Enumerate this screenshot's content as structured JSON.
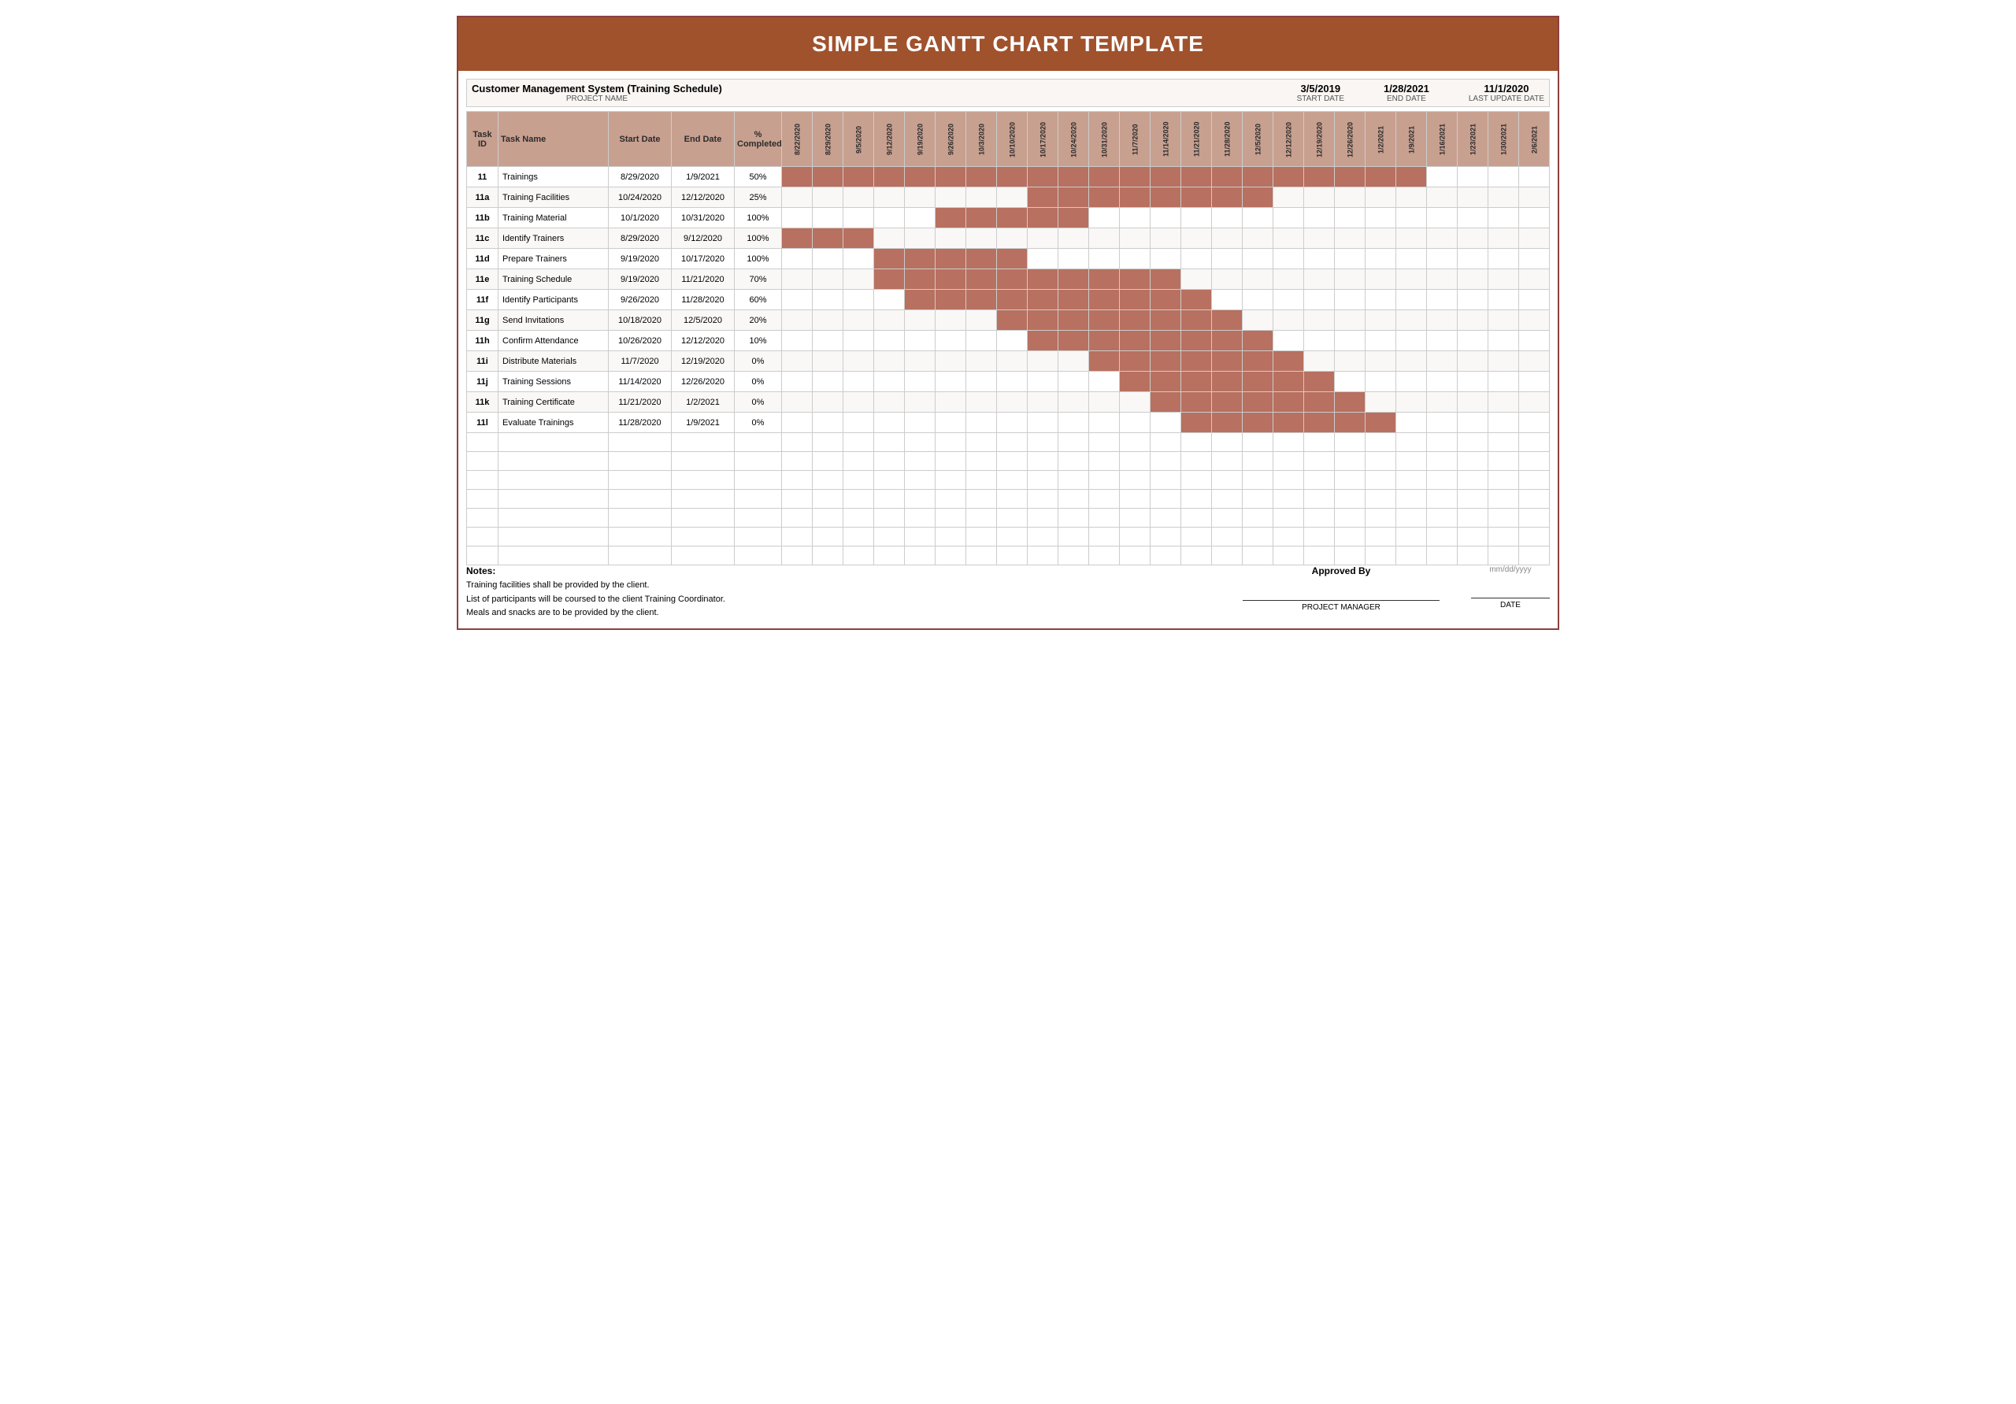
{
  "title": "SIMPLE GANTT CHART TEMPLATE",
  "project": {
    "name": "Customer Management System (Training Schedule)",
    "name_label": "PROJECT NAME",
    "start_date": "3/5/2019",
    "start_label": "START DATE",
    "end_date": "1/28/2021",
    "end_label": "END DATE",
    "last_update": "11/1/2020",
    "last_update_label": "LAST UPDATE DATE"
  },
  "columns": {
    "task_id": "Task ID",
    "task_name": "Task Name",
    "start_date": "Start Date",
    "end_date": "End Date",
    "pct_completed": "% Completed"
  },
  "date_headers": [
    "8/22/2020",
    "8/29/2020",
    "9/5/2020",
    "9/12/2020",
    "9/19/2020",
    "9/26/2020",
    "10/3/2020",
    "10/10/2020",
    "10/17/2020",
    "10/24/2020",
    "10/31/2020",
    "11/7/2020",
    "11/14/2020",
    "11/21/2020",
    "11/28/2020",
    "12/5/2020",
    "12/12/2020",
    "12/19/2020",
    "12/26/2020",
    "1/2/2021",
    "1/9/2021",
    "1/16/2021",
    "1/23/2021",
    "1/30/2021",
    "2/6/2021"
  ],
  "tasks": [
    {
      "id": "11",
      "name": "Trainings",
      "start": "8/29/2020",
      "end": "1/9/2021",
      "pct": "50%",
      "bars": [
        1,
        2,
        3,
        4,
        5,
        6,
        7,
        8,
        9,
        10,
        11,
        12,
        13,
        14,
        15,
        16,
        17,
        18,
        19,
        20,
        21
      ]
    },
    {
      "id": "11a",
      "name": "Training Facilities",
      "start": "10/24/2020",
      "end": "12/12/2020",
      "pct": "25%",
      "bars": [
        9,
        10,
        11,
        12,
        13,
        14,
        15,
        16
      ]
    },
    {
      "id": "11b",
      "name": "Training Material",
      "start": "10/1/2020",
      "end": "10/31/2020",
      "pct": "100%",
      "bars": [
        6,
        7,
        8,
        9,
        10
      ]
    },
    {
      "id": "11c",
      "name": "Identify Trainers",
      "start": "8/29/2020",
      "end": "9/12/2020",
      "pct": "100%",
      "bars": [
        1,
        2,
        3
      ]
    },
    {
      "id": "11d",
      "name": "Prepare Trainers",
      "start": "9/19/2020",
      "end": "10/17/2020",
      "pct": "100%",
      "bars": [
        4,
        5,
        6,
        7,
        8
      ]
    },
    {
      "id": "11e",
      "name": "Training Schedule",
      "start": "9/19/2020",
      "end": "11/21/2020",
      "pct": "70%",
      "bars": [
        4,
        5,
        6,
        7,
        8,
        9,
        10,
        11,
        12,
        13
      ]
    },
    {
      "id": "11f",
      "name": "Identify Participants",
      "start": "9/26/2020",
      "end": "11/28/2020",
      "pct": "60%",
      "bars": [
        5,
        6,
        7,
        8,
        9,
        10,
        11,
        12,
        13,
        14
      ]
    },
    {
      "id": "11g",
      "name": "Send Invitations",
      "start": "10/18/2020",
      "end": "12/5/2020",
      "pct": "20%",
      "bars": [
        8,
        9,
        10,
        11,
        12,
        13,
        14,
        15
      ]
    },
    {
      "id": "11h",
      "name": "Confirm Attendance",
      "start": "10/26/2020",
      "end": "12/12/2020",
      "pct": "10%",
      "bars": [
        9,
        10,
        11,
        12,
        13,
        14,
        15,
        16
      ]
    },
    {
      "id": "11i",
      "name": "Distribute Materials",
      "start": "11/7/2020",
      "end": "12/19/2020",
      "pct": "0%",
      "bars": [
        11,
        12,
        13,
        14,
        15,
        16,
        17
      ]
    },
    {
      "id": "11j",
      "name": "Training Sessions",
      "start": "11/14/2020",
      "end": "12/26/2020",
      "pct": "0%",
      "bars": [
        12,
        13,
        14,
        15,
        16,
        17,
        18
      ]
    },
    {
      "id": "11k",
      "name": "Training Certificate",
      "start": "11/21/2020",
      "end": "1/2/2021",
      "pct": "0%",
      "bars": [
        13,
        14,
        15,
        16,
        17,
        18,
        19
      ]
    },
    {
      "id": "11l",
      "name": "Evaluate Trainings",
      "start": "11/28/2020",
      "end": "1/9/2021",
      "pct": "0%",
      "bars": [
        14,
        15,
        16,
        17,
        18,
        19,
        20
      ]
    }
  ],
  "empty_rows": 7,
  "notes": {
    "title": "Notes:",
    "lines": [
      "Training facilities shall be provided by the client.",
      "List of participants will be coursed to the client Training Coordinator.",
      "Meals and snacks are to be provided by the client."
    ]
  },
  "approved_by": "Approved By",
  "project_manager_label": "PROJECT MANAGER",
  "date_label": "DATE",
  "date_placeholder": "mm/dd/yyyy"
}
